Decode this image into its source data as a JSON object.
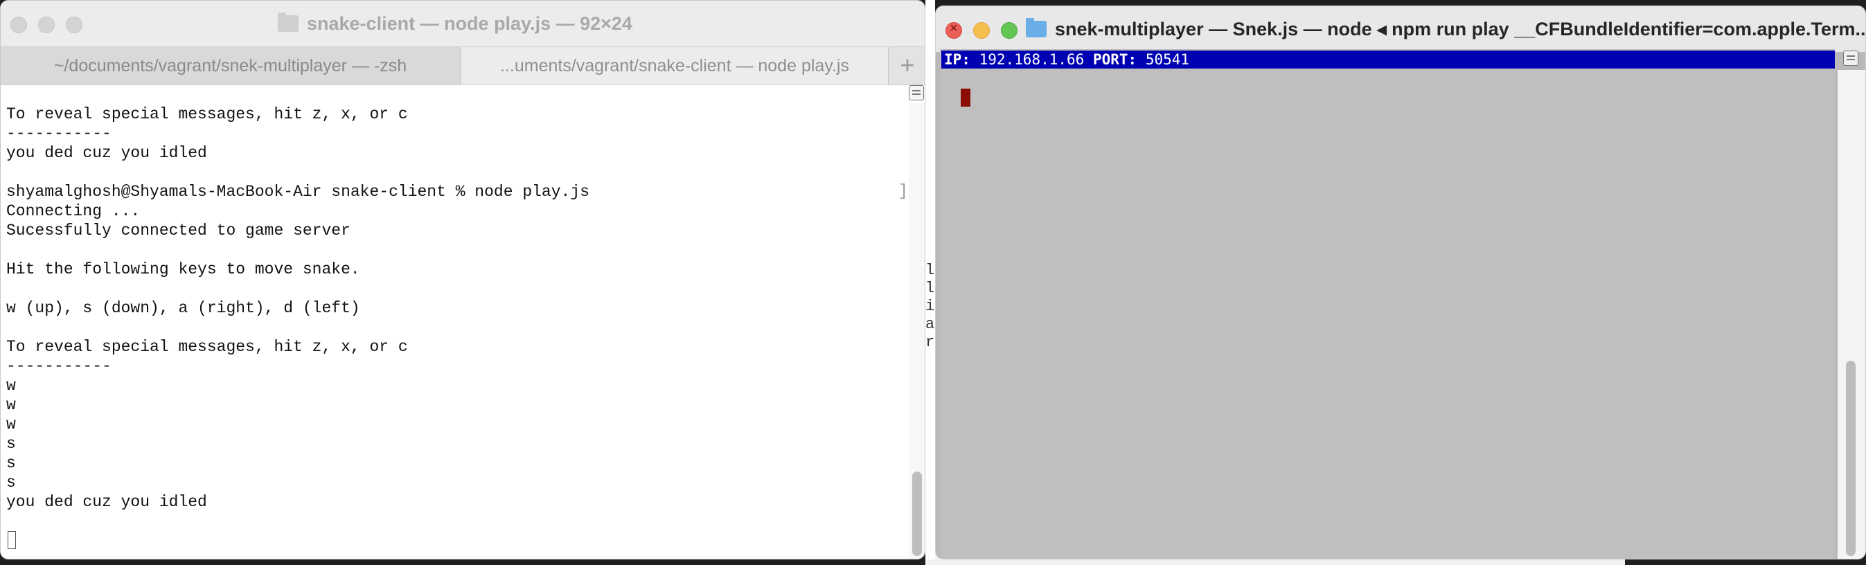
{
  "left_window": {
    "title": "snake-client — node play.js — 92×24",
    "tabs": [
      {
        "label": "~/documents/vagrant/snek-multiplayer — -zsh"
      },
      {
        "label": "...uments/vagrant/snake-client — node play.js"
      }
    ],
    "new_tab_symbol": "+",
    "terminal_lines": [
      "To reveal special messages, hit z, x, or c",
      "-----------",
      "you ded cuz you idled",
      "",
      "shyamalghosh@Shyamals-MacBook-Air snake-client % node play.js",
      "Connecting ...",
      "Sucessfully connected to game server",
      "",
      "Hit the following keys to move snake.",
      "",
      "w (up), s (down), a (right), d (left)",
      "",
      "To reveal special messages, hit z, x, or c",
      "-----------",
      "w",
      "w",
      "w",
      "s",
      "s",
      "s",
      "you ded cuz you idled"
    ],
    "bracket_mark": "]"
  },
  "background_window_slice": [
    "la",
    "la",
    "i",
    "a",
    "rt"
  ],
  "right_window": {
    "title": "snek-multiplayer — Snek.js — node ◂ npm run play __CFBundleIdentifier=com.apple.Term...",
    "status": {
      "ip_label": "IP:",
      "ip_value": "192.168.1.66",
      "port_label": "PORT:",
      "port_value": "50541"
    },
    "snake_color": "#8b0c00",
    "status_bar_color": "#0000b3"
  }
}
